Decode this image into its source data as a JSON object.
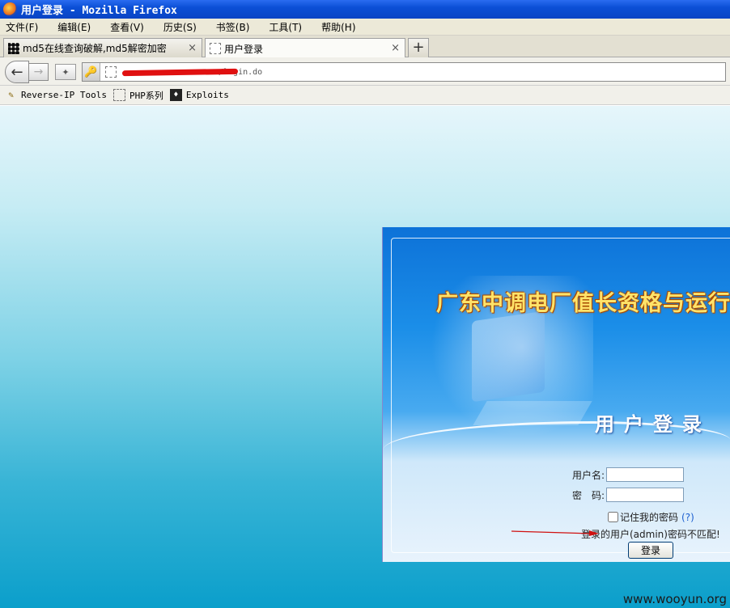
{
  "window": {
    "title": "用户登录 - Mozilla Firefox"
  },
  "menu": [
    "文件(F)",
    "编辑(E)",
    "查看(V)",
    "历史(S)",
    "书签(B)",
    "工具(T)",
    "帮助(H)"
  ],
  "tabs": [
    {
      "label": "md5在线查询破解,md5解密加密",
      "close": "×"
    },
    {
      "label": "用户登录",
      "close": "×"
    }
  ],
  "new_tab": "+",
  "address": {
    "url": "/login.do"
  },
  "bookmarks": [
    "Reverse-IP Tools",
    "PHP系列",
    "Exploits"
  ],
  "login": {
    "system_title": "广东中调电厂值长资格与运行",
    "heading": "用户登录",
    "username_label": "用户名:",
    "username_value": "",
    "password_label": "密　码:",
    "password_value": "",
    "remember_label": "记住我的密码",
    "help": "(?)",
    "error": "登录的用户(admin)密码不匹配!",
    "submit": "登录"
  },
  "watermark": "www.wooyun.org",
  "colors": {
    "annotation_red": "#e01010"
  }
}
